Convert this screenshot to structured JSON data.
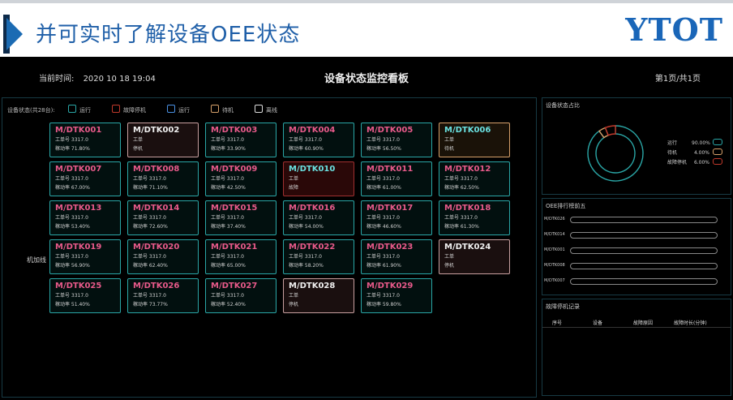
{
  "slide": {
    "title": "并可实时了解设备OEE状态",
    "brand": "YTOT"
  },
  "dashboard": {
    "header": {
      "time_label": "当前时间:",
      "time_value": "2020 10 18 19:04",
      "title": "设备状态监控看板",
      "page": "第1页/共1页"
    },
    "legend": {
      "caption": "设备状态(共28台):",
      "items": [
        {
          "label": "运行",
          "color": "#2aa6a6"
        },
        {
          "label": "故障停机",
          "color": "#c0392b"
        },
        {
          "label": "运行",
          "color": "#4a90e2"
        },
        {
          "label": "待机",
          "color": "#d6a06a"
        },
        {
          "label": "离线",
          "color": "#dddddd"
        }
      ]
    },
    "line_label": "机加线",
    "cards": [
      {
        "id": "M/DTK001",
        "l2": "工单号 3317.0",
        "l3": "稼动率 71.80%",
        "state": "run"
      },
      {
        "id": "M/DTK002",
        "l2": "工单",
        "l3": "停机",
        "state": "stop"
      },
      {
        "id": "M/DTK003",
        "l2": "工单号 3317.0",
        "l3": "稼动率 33.90%",
        "state": "run"
      },
      {
        "id": "M/DTK004",
        "l2": "工单号 3317.0",
        "l3": "稼动率 60.90%",
        "state": "run"
      },
      {
        "id": "M/DTK005",
        "l2": "工单号 3317.0",
        "l3": "稼动率 56.50%",
        "state": "run"
      },
      {
        "id": "M/DTK006",
        "l2": "工单",
        "l3": "待机",
        "state": "alarm"
      },
      {
        "id": "M/DTK007",
        "l2": "工单号 3317.0",
        "l3": "稼动率 67.00%",
        "state": "run"
      },
      {
        "id": "M/DTK008",
        "l2": "工单号 3317.0",
        "l3": "稼动率 71.10%",
        "state": "run"
      },
      {
        "id": "M/DTK009",
        "l2": "工单号 3317.0",
        "l3": "稼动率 42.50%",
        "state": "run"
      },
      {
        "id": "M/DTK010",
        "l2": "工单",
        "l3": "故障",
        "state": "fault"
      },
      {
        "id": "M/DTK011",
        "l2": "工单号 3317.0",
        "l3": "稼动率 61.00%",
        "state": "run"
      },
      {
        "id": "M/DTK012",
        "l2": "工单号 3317.0",
        "l3": "稼动率 62.50%",
        "state": "run"
      },
      {
        "id": "M/DTK013",
        "l2": "工单号 3317.0",
        "l3": "稼动率 53.40%",
        "state": "run"
      },
      {
        "id": "M/DTK014",
        "l2": "工单号 3317.0",
        "l3": "稼动率 72.60%",
        "state": "run"
      },
      {
        "id": "M/DTK015",
        "l2": "工单号 3317.0",
        "l3": "稼动率 37.40%",
        "state": "run"
      },
      {
        "id": "M/DTK016",
        "l2": "工单号 3317.0",
        "l3": "稼动率 54.00%",
        "state": "run"
      },
      {
        "id": "M/DTK017",
        "l2": "工单号 3317.0",
        "l3": "稼动率 46.60%",
        "state": "run"
      },
      {
        "id": "M/DTK018",
        "l2": "工单号 3317.0",
        "l3": "稼动率 61.30%",
        "state": "run"
      },
      {
        "id": "M/DTK019",
        "l2": "工单号 3317.0",
        "l3": "稼动率 56.90%",
        "state": "run"
      },
      {
        "id": "M/DTK020",
        "l2": "工单号 3317.0",
        "l3": "稼动率 62.40%",
        "state": "run"
      },
      {
        "id": "M/DTK021",
        "l2": "工单号 3317.0",
        "l3": "稼动率 65.00%",
        "state": "run"
      },
      {
        "id": "M/DTK022",
        "l2": "工单号 3317.0",
        "l3": "稼动率 58.20%",
        "state": "run"
      },
      {
        "id": "M/DTK023",
        "l2": "工单号 3317.0",
        "l3": "稼动率 61.90%",
        "state": "run"
      },
      {
        "id": "M/DTK024",
        "l2": "工单",
        "l3": "停机",
        "state": "stop"
      },
      {
        "id": "M/DTK025",
        "l2": "工单号 3317.0",
        "l3": "稼动率 51.40%",
        "state": "run"
      },
      {
        "id": "M/DTK026",
        "l2": "工单号 3317.0",
        "l3": "稼动率 73.77%",
        "state": "run"
      },
      {
        "id": "M/DTK027",
        "l2": "工单号 3317.0",
        "l3": "稼动率 52.40%",
        "state": "run"
      },
      {
        "id": "M/DTK028",
        "l2": "工单",
        "l3": "停机",
        "state": "stop"
      },
      {
        "id": "M/DTK029",
        "l2": "工单号 3317.0",
        "l3": "稼动率 59.80%",
        "state": "run"
      }
    ],
    "status_panel": {
      "title": "设备状态占比",
      "items": [
        {
          "label": "运行",
          "pct": "90.00%",
          "value": 90,
          "color": "#2aa6a6"
        },
        {
          "label": "待机",
          "pct": "4.00%",
          "value": 4,
          "color": "#d6a06a"
        },
        {
          "label": "故障停机",
          "pct": "6.00%",
          "value": 6,
          "color": "#c0392b"
        }
      ]
    },
    "oee_panel": {
      "title": "OEE排行榜前五",
      "rows": [
        {
          "label": "M/DTK026",
          "value": 0.0
        },
        {
          "label": "M/DTK014",
          "value": 0.0
        },
        {
          "label": "M/DTK001",
          "value": 0.0
        },
        {
          "label": "M/DTK008",
          "value": 0.0
        },
        {
          "label": "M/DTK007",
          "value": 0.0
        }
      ]
    },
    "fault_panel": {
      "title": "故障停机记录",
      "columns": [
        "序号",
        "设备",
        "故障原因",
        "故障时长(分钟)"
      ]
    }
  }
}
